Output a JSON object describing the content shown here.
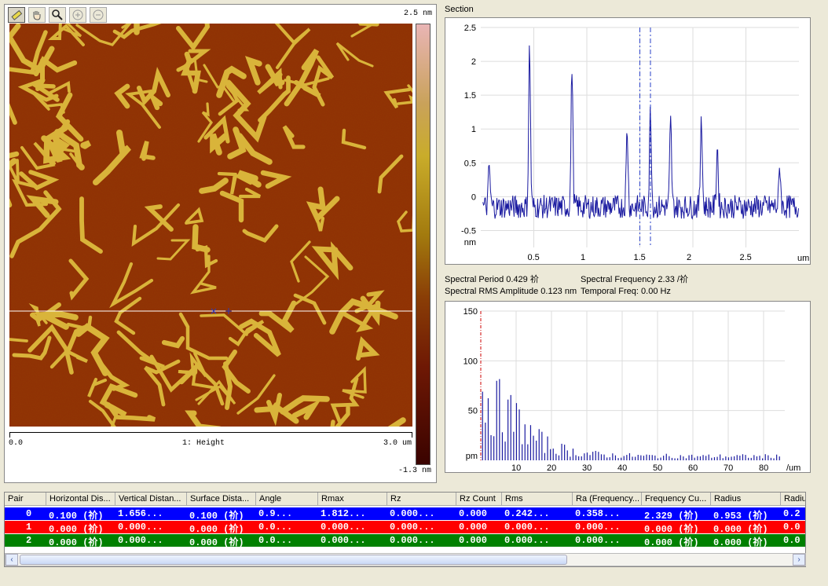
{
  "toolbar": {
    "tools": [
      "ruler-icon",
      "hand-icon",
      "magnifier-icon",
      "zoom-in-icon",
      "zoom-out-icon"
    ]
  },
  "image": {
    "zmax": "2.5 nm",
    "zmin": "-1.3 nm",
    "x_start": "0.0",
    "channel": "1: Height",
    "x_end": "3.0 um"
  },
  "section": {
    "title": "Section",
    "chart_data": {
      "type": "line",
      "xlabel": "um",
      "ylabel": "nm",
      "xlim": [
        0,
        3.0
      ],
      "ylim": [
        -0.75,
        2.5
      ],
      "xticks": [
        "0.5",
        "1",
        "1.5",
        "2",
        "2.5"
      ],
      "yticks": [
        "2.5",
        "2",
        "1.5",
        "1",
        "0.5",
        "0",
        "-0.5"
      ],
      "cursors_x": [
        1.5,
        1.6
      ],
      "peaks": [
        [
          0.08,
          0.6
        ],
        [
          0.46,
          2.35
        ],
        [
          0.86,
          2.1
        ],
        [
          1.38,
          1.15
        ],
        [
          1.6,
          1.45
        ],
        [
          1.79,
          1.25
        ],
        [
          2.08,
          1.4
        ],
        [
          2.23,
          0.9
        ],
        [
          2.82,
          0.6
        ]
      ]
    },
    "spectral_period": "Spectral Period 0.429 祄",
    "spectral_frequency": "Spectral Frequency 2.33 /祄",
    "rms_amplitude": "Spectral RMS Amplitude 0.123 nm",
    "temporal_freq": "Temporal Freq: 0.00 Hz"
  },
  "spectrum": {
    "chart_data": {
      "type": "bar",
      "xlabel": "/um",
      "ylabel": "pm",
      "xlim": [
        0,
        86
      ],
      "ylim": [
        0,
        150
      ],
      "xticks": [
        "10",
        "20",
        "30",
        "40",
        "50",
        "60",
        "70",
        "80"
      ],
      "yticks": [
        "150",
        "100",
        "50"
      ]
    }
  },
  "table": {
    "headers": [
      "Pair",
      "Horizontal Dis...",
      "Vertical Distan...",
      "Surface Dista...",
      "Angle",
      "Rmax",
      "Rz",
      "Rz Count",
      "Rms",
      "Ra (Frequency...",
      "Frequency Cu...",
      "Radius",
      "Radiu"
    ],
    "rows": [
      {
        "color": "#0000FF",
        "cells": [
          "0",
          "0.100 (祄)",
          "1.656...",
          "0.100 (祄)",
          "0.9...",
          "1.812...",
          "0.000...",
          "0.000",
          "0.242...",
          "0.358...",
          "2.329 (祄)",
          "0.953 (祄)",
          "0.2"
        ]
      },
      {
        "color": "#FF0000",
        "cells": [
          "1",
          "0.000 (祄)",
          "0.000...",
          "0.000 (祄)",
          "0.0...",
          "0.000...",
          "0.000...",
          "0.000",
          "0.000...",
          "0.000...",
          "0.000 (祄)",
          "0.000 (祄)",
          "0.0"
        ]
      },
      {
        "color": "#008000",
        "cells": [
          "2",
          "0.000 (祄)",
          "0.000...",
          "0.000 (祄)",
          "0.0...",
          "0.000...",
          "0.000...",
          "0.000",
          "0.000...",
          "0.000...",
          "0.000 (祄)",
          "0.000 (祄)",
          "0.0"
        ]
      }
    ]
  }
}
